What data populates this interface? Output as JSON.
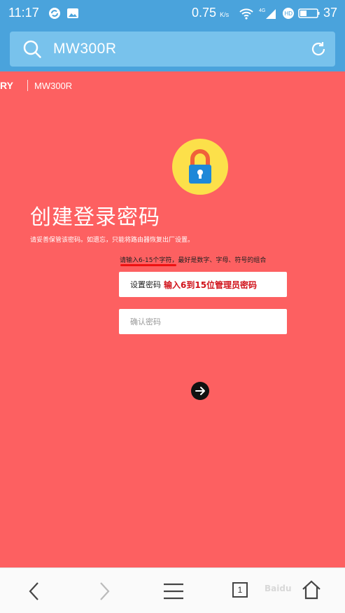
{
  "status_bar": {
    "time": "11:17",
    "network_speed": "0.75",
    "network_unit": "K/s",
    "battery": "37"
  },
  "address_bar": {
    "url": "MW300R"
  },
  "page": {
    "brand": "RY",
    "model": "MW300R",
    "title": "创建登录密码",
    "tip": "请妥善保管该密码。如遗忘，只能将路由器恢复出厂设置。",
    "hint": "请输入6-15个字符，最好是数字、字母、符号的组合",
    "password_placeholder": "设置密码",
    "confirm_placeholder": "确认密码",
    "annotation": "输入6到15位管理员密码"
  },
  "bottom_bar": {
    "tab_count": "1",
    "watermark": "Baidu"
  },
  "colors": {
    "page_bg": "#fd6061",
    "header_bg": "#4aa3dc",
    "lock_circle": "#fce04a",
    "lock_body": "#1e88d8",
    "lock_shackle": "#f0603a",
    "annotation": "#d0121a"
  }
}
